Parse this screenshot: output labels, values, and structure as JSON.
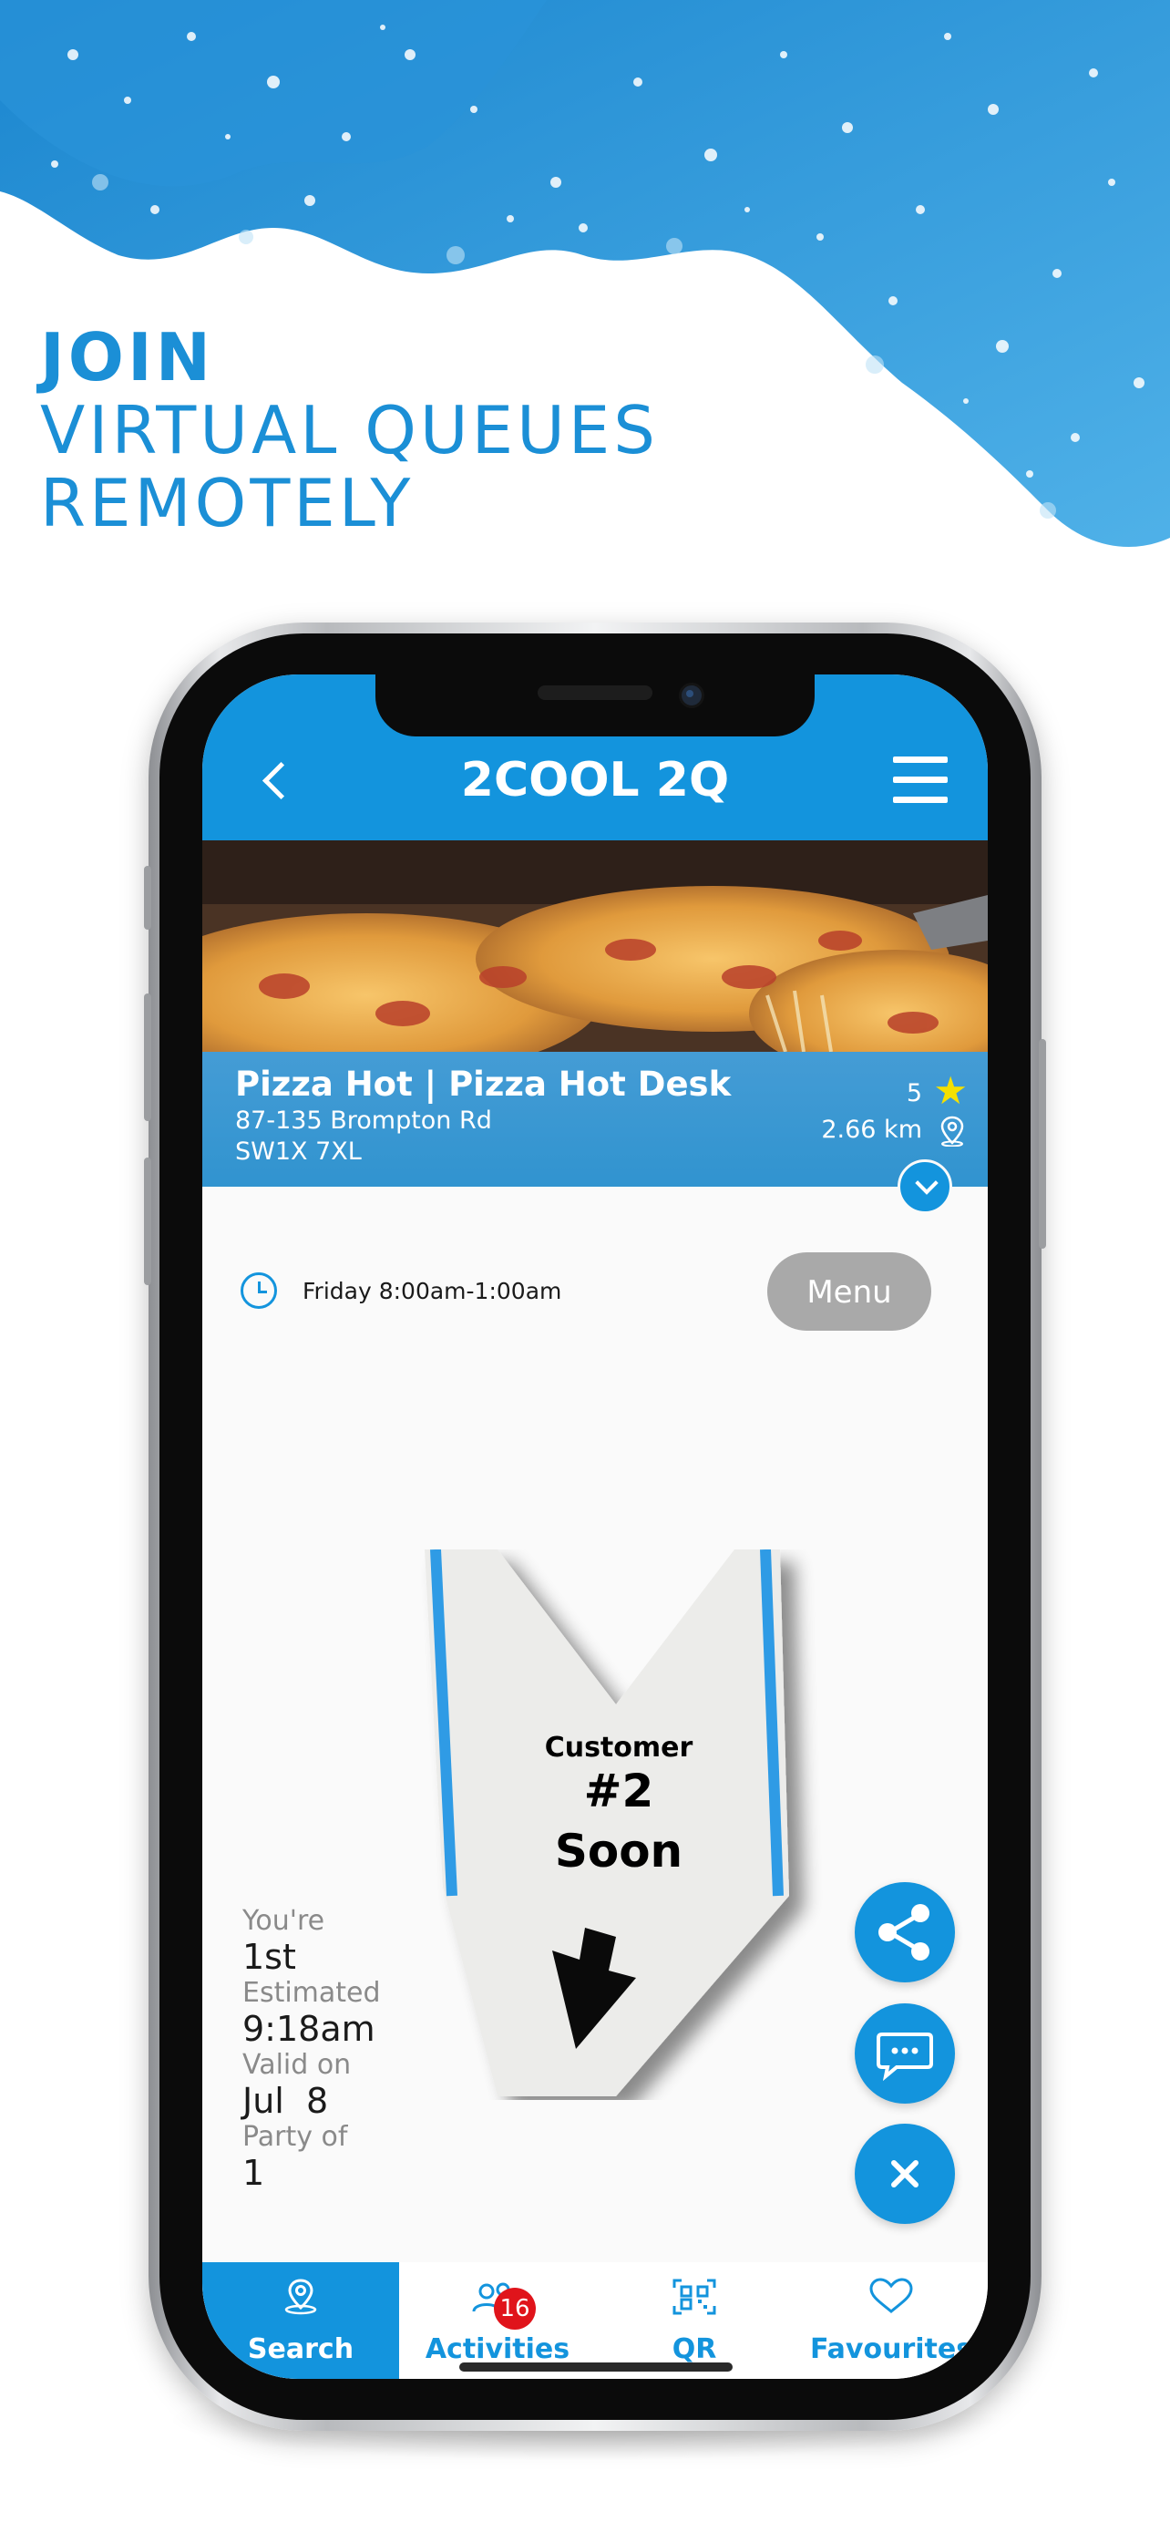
{
  "promo": {
    "line1": "JOIN",
    "line2": "VIRTUAL QUEUES",
    "line3": "REMOTELY"
  },
  "app": {
    "title": "2COOL 2Q",
    "back_icon": "chevron-left-icon",
    "menu_icon": "hamburger-icon"
  },
  "venue": {
    "name": "Pizza Hot | Pizza Hot Desk",
    "address_line1": "87-135 Brompton Rd",
    "address_line2": "SW1X 7XL",
    "rating": "5",
    "distance": "2.66 km"
  },
  "hours": {
    "text": "Friday 8:00am-1:00am",
    "menu_label": "Menu"
  },
  "ticket": {
    "heading": "Customer",
    "number": "#2",
    "status": "Soon"
  },
  "queue": {
    "position_label": "You're",
    "position_value": "1st",
    "estimated_label": "Estimated",
    "estimated_value": "9:18am",
    "valid_label": "Valid on",
    "valid_value": "Jul  8",
    "party_label": "Party of",
    "party_value": "1"
  },
  "actions": [
    {
      "name": "share-icon"
    },
    {
      "name": "chat-icon"
    },
    {
      "name": "close-icon"
    }
  ],
  "tabs": [
    {
      "label": "Search",
      "icon": "location-pin-icon",
      "active": true
    },
    {
      "label": "Activities",
      "icon": "users-icon",
      "badge": "16",
      "active": false
    },
    {
      "label": "QR",
      "icon": "qr-code-icon",
      "active": false
    },
    {
      "label": "Favourites",
      "icon": "heart-icon",
      "active": false
    }
  ],
  "colors": {
    "brand_blue": "#1394dd",
    "badge_red": "#e0141b",
    "menu_button_grey": "#a9a9a9"
  }
}
